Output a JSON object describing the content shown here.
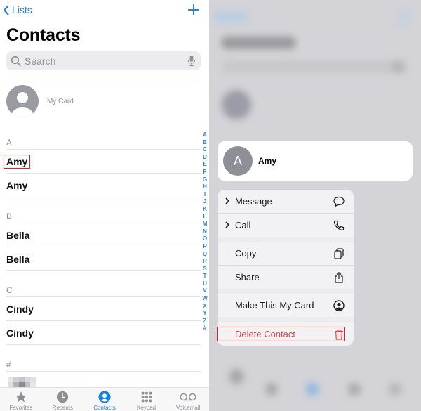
{
  "nav": {
    "back_label": "Lists",
    "add_icon": "plus-icon"
  },
  "title": "Contacts",
  "search": {
    "placeholder": "Search",
    "value": ""
  },
  "my_card": {
    "label": "My Card"
  },
  "sections": [
    {
      "header": "A",
      "contacts": [
        "Amy",
        "Amy"
      ]
    },
    {
      "header": "B",
      "contacts": [
        "Bella",
        "Bella"
      ]
    },
    {
      "header": "C",
      "contacts": [
        "Cindy",
        "Cindy"
      ]
    },
    {
      "header": "#",
      "contacts": []
    }
  ],
  "index_letters": [
    "A",
    "B",
    "C",
    "D",
    "E",
    "F",
    "G",
    "H",
    "I",
    "J",
    "K",
    "L",
    "M",
    "N",
    "O",
    "P",
    "Q",
    "R",
    "S",
    "T",
    "U",
    "V",
    "W",
    "X",
    "Y",
    "Z",
    "#"
  ],
  "tabbar": {
    "tabs": [
      {
        "label": "Favorites",
        "icon": "star-icon"
      },
      {
        "label": "Recents",
        "icon": "clock-icon"
      },
      {
        "label": "Contacts",
        "icon": "person-circle-icon",
        "active": true
      },
      {
        "label": "Keypad",
        "icon": "keypad-icon"
      },
      {
        "label": "Voicemail",
        "icon": "voicemail-icon"
      }
    ]
  },
  "context": {
    "contact_initial": "A",
    "contact_name": "Amy",
    "menu": [
      {
        "label": "Message",
        "icon": "message-bubble-icon",
        "submenu": true
      },
      {
        "label": "Call",
        "icon": "phone-icon",
        "submenu": true
      },
      {
        "label": "Copy",
        "icon": "copy-icon"
      },
      {
        "label": "Share",
        "icon": "share-icon"
      },
      {
        "label": "Make This My Card",
        "icon": "person-circle-icon"
      },
      {
        "label": "Delete Contact",
        "icon": "trash-icon",
        "destructive": true
      }
    ]
  },
  "colors": {
    "accent": "#2a7fcf",
    "destructive": "#d9484b",
    "highlight": "#e02020"
  }
}
